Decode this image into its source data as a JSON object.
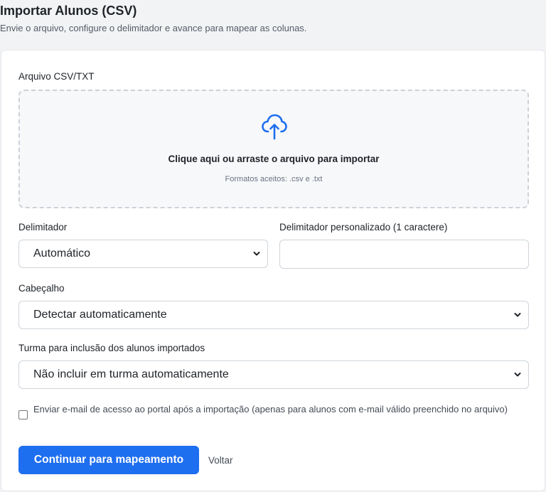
{
  "header": {
    "title": "Importar Alunos (CSV)",
    "subtitle": "Envie o arquivo, configure o delimitador e avance para mapear as colunas."
  },
  "file": {
    "label": "Arquivo CSV/TXT",
    "dropzone_title": "Clique aqui ou arraste o arquivo para importar",
    "dropzone_hint": "Formatos aceitos: .csv e .txt",
    "icon": "cloud-upload-icon"
  },
  "delimiter": {
    "label": "Delimitador",
    "value": "Automático"
  },
  "custom_delimiter": {
    "label": "Delimitador personalizado (1 caractere)",
    "value": ""
  },
  "header_option": {
    "label": "Cabeçalho",
    "value": "Detectar automaticamente"
  },
  "class_option": {
    "label": "Turma para inclusão dos alunos importados",
    "value": "Não incluir em turma automaticamente"
  },
  "email_option": {
    "label": "Enviar e-mail de acesso ao portal após a importação (apenas para alunos com e-mail válido preenchido no arquivo)",
    "checked": false
  },
  "actions": {
    "continue_label": "Continuar para mapeamento",
    "back_label": "Voltar"
  },
  "colors": {
    "accent": "#1e6ef0",
    "background": "#f2f3f5"
  }
}
